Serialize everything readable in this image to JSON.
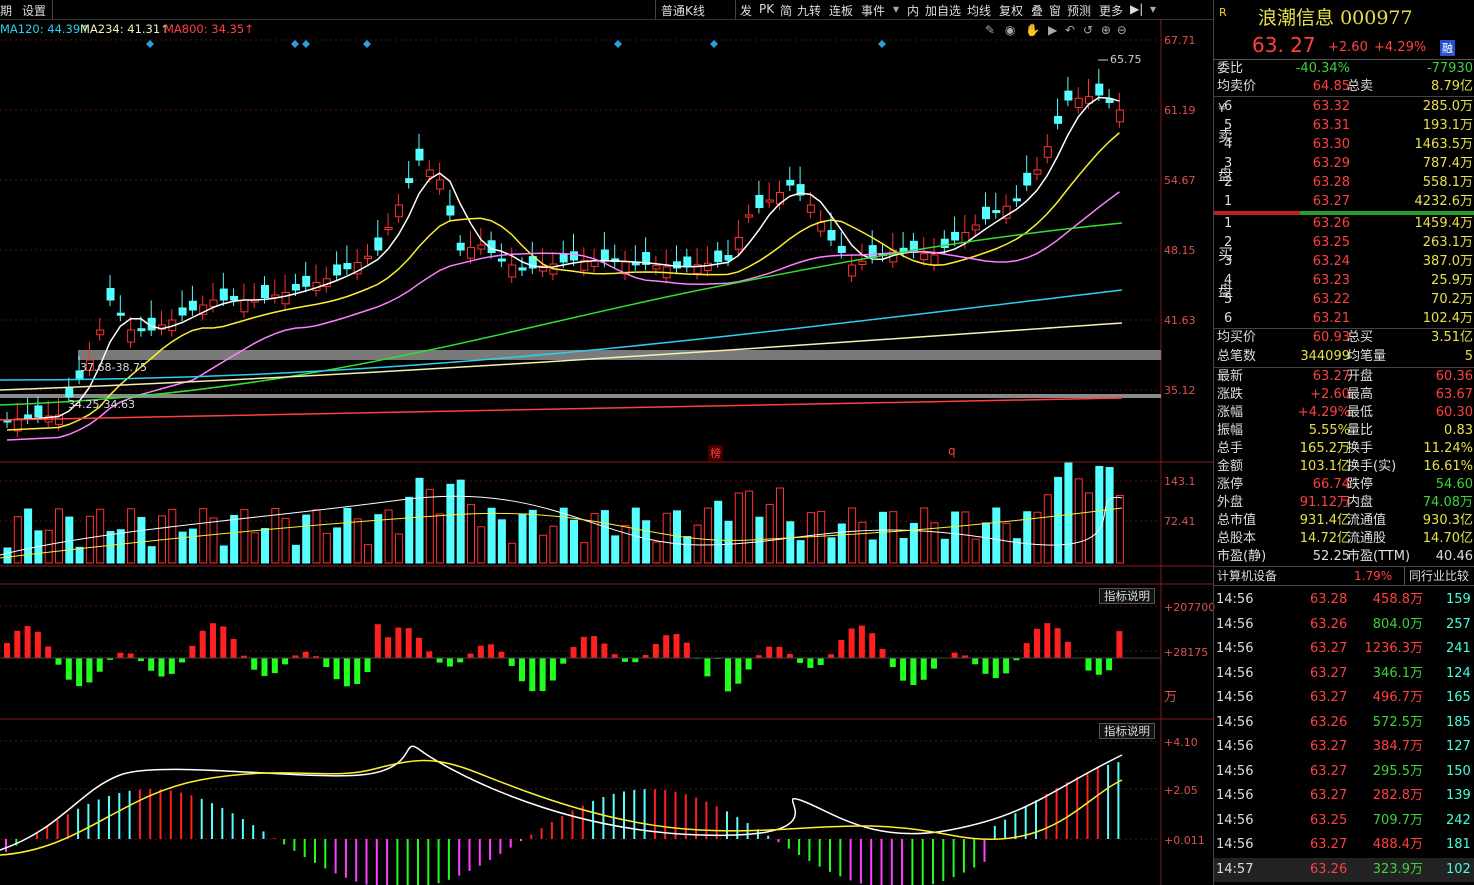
{
  "toolbar": {
    "items": [
      "期",
      "设置",
      "普通K线",
      "发",
      "PK",
      "简",
      "九转",
      "连板",
      "事件",
      "内",
      "加自选",
      "均线",
      "复权",
      "叠",
      "窗",
      "预测",
      "更多"
    ]
  },
  "ma_legend": [
    {
      "text": "MA120: 44.39↑",
      "color": "#2bd0f0"
    },
    {
      "text": "MA234: 41.31↑",
      "color": "#f3f0b0"
    },
    {
      "text": "MA800: 34.35↑",
      "color": "#ff4040"
    }
  ],
  "price_axis": [
    "67.71",
    "61.19",
    "54.67",
    "48.15",
    "41.63",
    "35.12"
  ],
  "volume_axis": [
    "143.1",
    "72.41"
  ],
  "flow_axis": [
    "+207700",
    "+28175",
    "万"
  ],
  "macd_axis": [
    "+4.10",
    "+2.05",
    "+0.011"
  ],
  "annotations": {
    "high": "65.75",
    "zone1": "37.68-38.75",
    "zone2": "34.25-34.63",
    "mark_bang": "榜",
    "mark_q": "q"
  },
  "buttons": {
    "indicator1": "指标说明",
    "indicator2": "指标说明"
  },
  "stock": {
    "market": "R",
    "name": "浪潮信息",
    "code": "000977",
    "price": "63. 27",
    "change": "+2.60",
    "pct": "+4.29%",
    "tag": "融"
  },
  "weibi": {
    "label": "委比",
    "pct": "-40.34%",
    "diff": "-77930"
  },
  "avg_sell": {
    "label": "均卖价",
    "value": "64.85",
    "label2": "总卖",
    "value2": "8.79亿"
  },
  "sell_label": "卖",
  "sell_label2": "盘",
  "yen": "¥",
  "sells": [
    {
      "n": "6",
      "p": "63.32",
      "v": "285.0万"
    },
    {
      "n": "5",
      "p": "63.31",
      "v": "193.1万"
    },
    {
      "n": "4",
      "p": "63.30",
      "v": "1463.5万"
    },
    {
      "n": "3",
      "p": "63.29",
      "v": "787.4万"
    },
    {
      "n": "2",
      "p": "63.28",
      "v": "558.1万"
    },
    {
      "n": "1",
      "p": "63.27",
      "v": "4232.6万"
    }
  ],
  "buy_label": "买",
  "buy_label2": "盘",
  "buys": [
    {
      "n": "1",
      "p": "63.26",
      "v": "1459.4万"
    },
    {
      "n": "2",
      "p": "63.25",
      "v": "263.1万"
    },
    {
      "n": "3",
      "p": "63.24",
      "v": "387.0万"
    },
    {
      "n": "4",
      "p": "63.23",
      "v": "25.9万"
    },
    {
      "n": "5",
      "p": "63.22",
      "v": "70.2万"
    },
    {
      "n": "6",
      "p": "63.21",
      "v": "102.4万"
    }
  ],
  "avg_buy": {
    "label": "均买价",
    "value": "60.93",
    "label2": "总买",
    "value2": "3.51亿"
  },
  "total_trades": {
    "label": "总笔数",
    "value": "344099",
    "label2": "均笔量",
    "value2": "5"
  },
  "stats": [
    {
      "l1": "最新",
      "v1": "63.27",
      "c1": "red",
      "l2": "开盘",
      "v2": "60.36",
      "c2": "red"
    },
    {
      "l1": "涨跌",
      "v1": "+2.60",
      "c1": "red",
      "l2": "最高",
      "v2": "63.67",
      "c2": "red"
    },
    {
      "l1": "涨幅",
      "v1": "+4.29%",
      "c1": "red",
      "l2": "最低",
      "v2": "60.30",
      "c2": "red"
    },
    {
      "l1": "振幅",
      "v1": "5.55%",
      "c1": "yel",
      "l2": "量比",
      "v2": "0.83",
      "c2": "yel"
    },
    {
      "l1": "总手",
      "v1": "165.2万",
      "c1": "yel",
      "l2": "换手",
      "v2": "11.24%",
      "c2": "yel"
    },
    {
      "l1": "金额",
      "v1": "103.1亿",
      "c1": "yel",
      "l2": "换手(实)",
      "v2": "16.61%",
      "c2": "yel"
    },
    {
      "l1": "涨停",
      "v1": "66.74",
      "c1": "red",
      "l2": "跌停",
      "v2": "54.60",
      "c2": "grn"
    },
    {
      "l1": "外盘",
      "v1": "91.12万",
      "c1": "red",
      "l2": "内盘",
      "v2": "74.08万",
      "c2": "grn"
    },
    {
      "l1": "总市值",
      "v1": "931.4亿",
      "c1": "yel",
      "l2": "流通值",
      "v2": "930.3亿",
      "c2": "yel"
    },
    {
      "l1": "总股本",
      "v1": "14.72亿",
      "c1": "yel",
      "l2": "流通股",
      "v2": "14.70亿",
      "c2": "yel"
    },
    {
      "l1": "市盈(静)",
      "v1": "52.25",
      "c1": "wht",
      "l2": "市盈(TTM)",
      "v2": "40.46",
      "c2": "wht"
    }
  ],
  "industry": {
    "name": "计算机设备",
    "pct": "1.79%",
    "compare": "同行业比较"
  },
  "ticks": [
    {
      "t": "14:56",
      "p": "63.28",
      "v": "458.8万",
      "vc": "red",
      "n": "159"
    },
    {
      "t": "14:56",
      "p": "63.26",
      "v": "804.0万",
      "vc": "grn",
      "n": "257"
    },
    {
      "t": "14:56",
      "p": "63.27",
      "v": "1236.3万",
      "vc": "red",
      "n": "241"
    },
    {
      "t": "14:56",
      "p": "63.27",
      "v": "346.1万",
      "vc": "grn",
      "n": "124"
    },
    {
      "t": "14:56",
      "p": "63.27",
      "v": "496.7万",
      "vc": "red",
      "n": "165"
    },
    {
      "t": "14:56",
      "p": "63.26",
      "v": "572.5万",
      "vc": "grn",
      "n": "185"
    },
    {
      "t": "14:56",
      "p": "63.27",
      "v": "384.7万",
      "vc": "red",
      "n": "127"
    },
    {
      "t": "14:56",
      "p": "63.27",
      "v": "295.5万",
      "vc": "grn",
      "n": "150"
    },
    {
      "t": "14:56",
      "p": "63.27",
      "v": "282.8万",
      "vc": "red",
      "n": "139"
    },
    {
      "t": "14:56",
      "p": "63.25",
      "v": "709.7万",
      "vc": "grn",
      "n": "242"
    },
    {
      "t": "14:56",
      "p": "63.27",
      "v": "488.4万",
      "vc": "red",
      "n": "181"
    },
    {
      "t": "14:57",
      "p": "63.26",
      "v": "323.9万",
      "vc": "grn",
      "n": "102"
    }
  ]
}
